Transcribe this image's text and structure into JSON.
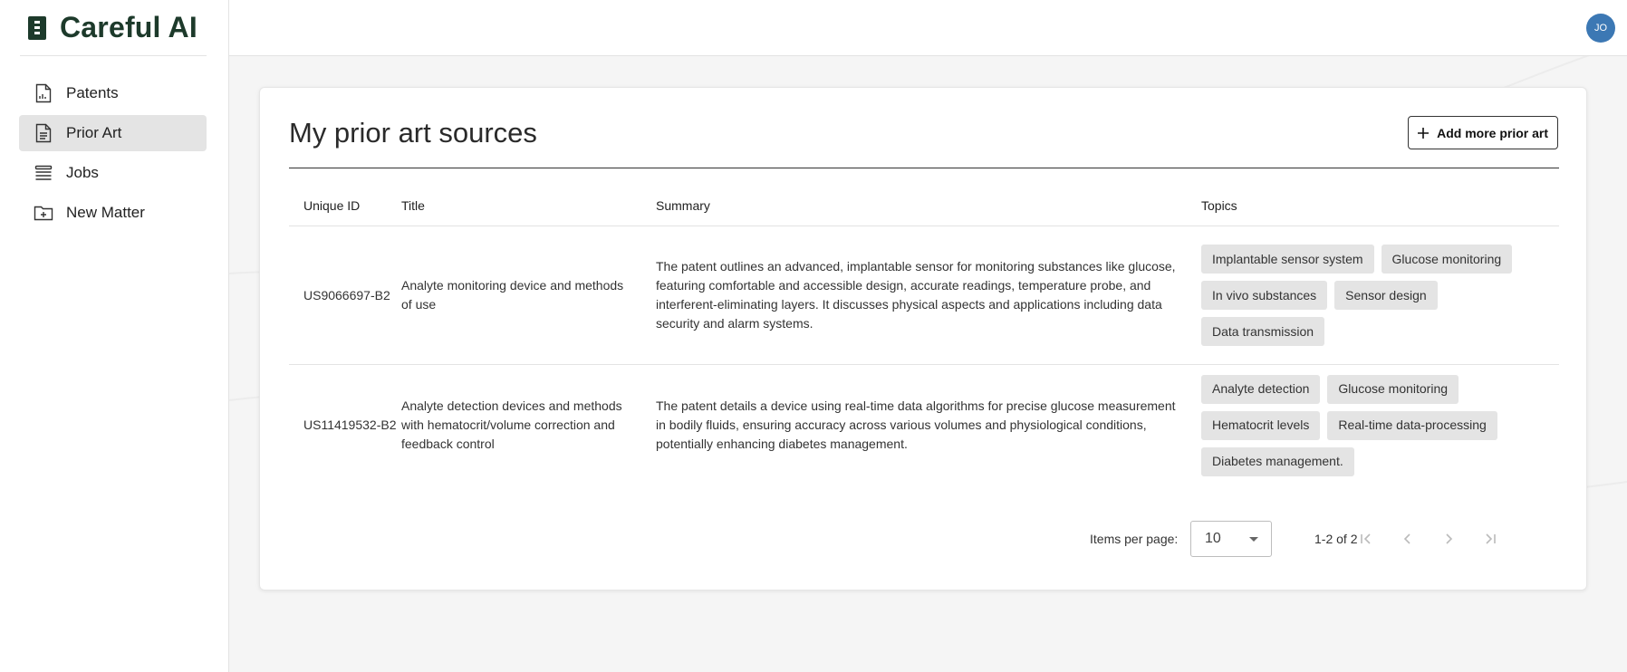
{
  "app": {
    "brand": "Careful AI",
    "avatar_initials": "JO",
    "accent": "#1d3a2b",
    "avatar_color": "#3c78b4"
  },
  "sidebar": {
    "items": [
      {
        "label": "Patents",
        "icon": "patent-document-icon",
        "active": false
      },
      {
        "label": "Prior Art",
        "icon": "document-icon",
        "active": true
      },
      {
        "label": "Jobs",
        "icon": "stack-icon",
        "active": false
      },
      {
        "label": "New Matter",
        "icon": "folder-plus-icon",
        "active": false
      }
    ]
  },
  "main": {
    "title": "My prior art sources",
    "add_button": "Add more prior art",
    "columns": {
      "id": "Unique ID",
      "title": "Title",
      "summary": "Summary",
      "topics": "Topics"
    },
    "rows": [
      {
        "id": "US9066697-B2",
        "title": "Analyte monitoring device and methods of use",
        "summary": "The patent outlines an advanced, implantable sensor for monitoring substances like glucose, featuring comfortable and accessible design, accurate readings, temperature probe, and interferent-eliminating layers. It discusses physical aspects and applications including data security and alarm systems.",
        "topics": [
          "Implantable sensor system",
          "Glucose monitoring",
          "In vivo substances",
          "Sensor design",
          "Data transmission"
        ]
      },
      {
        "id": "US11419532-B2",
        "title": "Analyte detection devices and methods with hematocrit/volume correction and feedback control",
        "summary": "The patent details a device using real-time data algorithms for precise glucose measurement in bodily fluids, ensuring accuracy across various volumes and physiological conditions, potentially enhancing diabetes management.",
        "topics": [
          "Analyte detection",
          "Glucose monitoring",
          "Hematocrit levels",
          "Real-time data-processing",
          "Diabetes management."
        ]
      }
    ]
  },
  "pagination": {
    "items_per_page_label": "Items per page:",
    "items_per_page": "10",
    "range": "1-2 of 2"
  }
}
